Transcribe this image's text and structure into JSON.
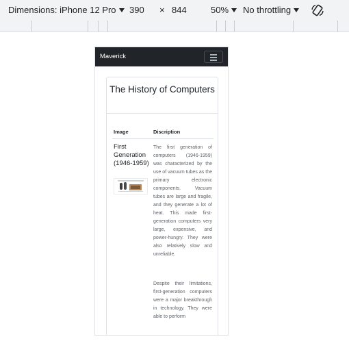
{
  "devtools": {
    "device_label": "Dimensions: iPhone 12 Pro",
    "width": "390",
    "times": "×",
    "height": "844",
    "zoom": "50%",
    "throttling": "No throttling",
    "rotate_icon": "rotate-icon"
  },
  "site": {
    "brand": "Maverick",
    "toggler_icon": "hamburger-menu-icon",
    "card_title": "The History of Computers",
    "table": {
      "headers": [
        "Image",
        "Discription"
      ],
      "row_title": "First Generation (1946-1959)",
      "image_icon": "vacuum-tube-photo",
      "paragraph1": "The first generation of computers (1946-1959) was characterized by the use of vacuum tubes as the primary electronic components. Vacuum tubes are large and fragile, and they generate a lot of heat. This made first-generation computers very large, expensive, and power-hungry. They were also relatively slow and unreliable.",
      "paragraph2": "Despite their limitations, first-generation computers were a major breakthrough in technology. They were able to perform"
    }
  }
}
